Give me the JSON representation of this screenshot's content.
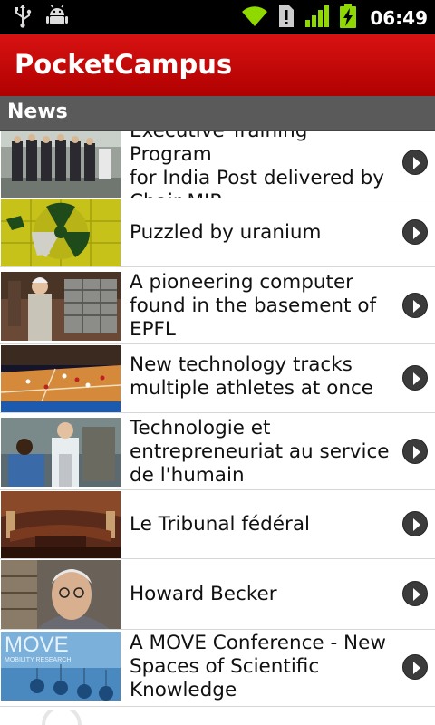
{
  "status_bar": {
    "time": "06:49",
    "icons": [
      "usb-icon",
      "android-debug-icon",
      "wifi-icon",
      "sim-alert-icon",
      "signal-icon",
      "battery-charging-icon"
    ]
  },
  "app": {
    "title": "PocketCampus"
  },
  "section": {
    "title": "News"
  },
  "news": [
    {
      "title_lines": [
        "Executive Training Program",
        "for India Post delivered by",
        "Chair MIR"
      ]
    },
    {
      "title_lines": [
        "Puzzled by uranium"
      ]
    },
    {
      "title_lines": [
        "A pioneering computer",
        "found in the basement of",
        "EPFL"
      ]
    },
    {
      "title_lines": [
        "New technology tracks",
        "multiple athletes at once"
      ]
    },
    {
      "title_lines": [
        "Technologie et",
        "entrepreneuriat au service",
        "de l'humain"
      ]
    },
    {
      "title_lines": [
        "Le Tribunal fédéral"
      ]
    },
    {
      "title_lines": [
        "Howard Becker"
      ]
    },
    {
      "title_lines": [
        "A MOVE Conference - New",
        "Spaces of Scientific",
        "Knowledge"
      ]
    }
  ],
  "thumbnails": {
    "move_logo": "MOVE",
    "move_caption": "MOBILITY RESEARCH"
  },
  "colors": {
    "appbar": "#c80000",
    "section": "#5a5a5a",
    "button": "#3b3b3b"
  }
}
